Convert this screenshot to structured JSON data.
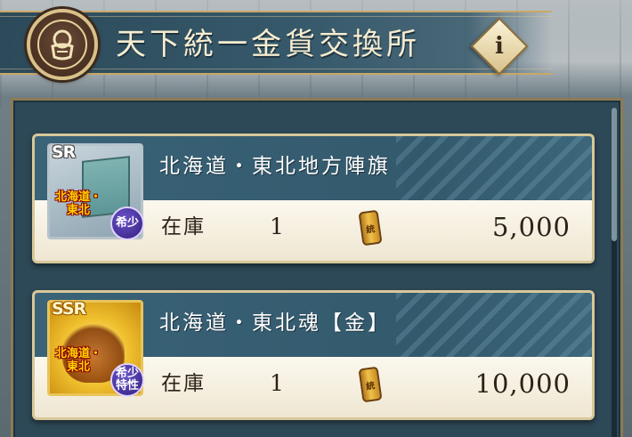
{
  "header": {
    "title": "天下統一金貨交換所",
    "info_label": "i"
  },
  "items": [
    {
      "rarity": "SR",
      "region_label": "北海道・東北",
      "badge": "希少",
      "name": "北海道・東北地方陣旗",
      "stock_label": "在庫",
      "stock": "1",
      "coin_mark": "統",
      "price": "5,000"
    },
    {
      "rarity": "SSR",
      "region_label": "北海道・東北",
      "badge": "希少特性",
      "name": "北海道・東北魂【金】",
      "stock_label": "在庫",
      "stock": "1",
      "coin_mark": "統",
      "price": "10,000"
    }
  ]
}
